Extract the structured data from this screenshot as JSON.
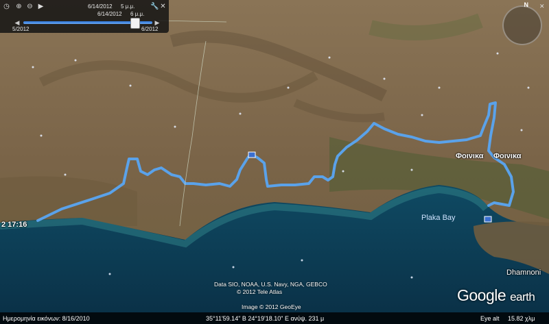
{
  "time_slider": {
    "start_date": "6/14/2012",
    "start_time": "5 μ.μ.",
    "end_date": "6/14/2012",
    "end_time": "6 μ.μ.",
    "left_label": "5/2012",
    "right_label": "6/2012",
    "icons": [
      "clock-icon",
      "zoom-in-icon",
      "zoom-out-icon",
      "play-icon",
      "wrench-icon",
      "close-icon",
      "prev-arrow-icon",
      "next-arrow-icon"
    ]
  },
  "map_labels": {
    "plaka_bay": "Plaka Bay",
    "foinika_1": "Φοινικα",
    "foinika_2": "Φοινικα",
    "dhamnoni": "Dhamnoni",
    "time_marker": "2 17:16"
  },
  "credits": {
    "data_line": "Data SIO, NOAA, U.S. Navy, NGA, GEBCO",
    "tele_atlas": "© 2012 Tele Atlas",
    "geoeye": "Image © 2012 GeoEye"
  },
  "logo": {
    "google": "Google",
    "earth": "earth"
  },
  "status_bar": {
    "imagery_date": "Ημερομηνία εικόνων: 8/16/2010",
    "coordinates": "35°11'59.14\" Β   24°19'18.10\" Ε  ανύψ.  231 μ",
    "eye_alt": "Eye alt",
    "eye_alt_value": "15.82 χλμ"
  },
  "colors": {
    "track": "#5aa2ea",
    "sea": "#0c3c57",
    "land": "#8a7150"
  }
}
